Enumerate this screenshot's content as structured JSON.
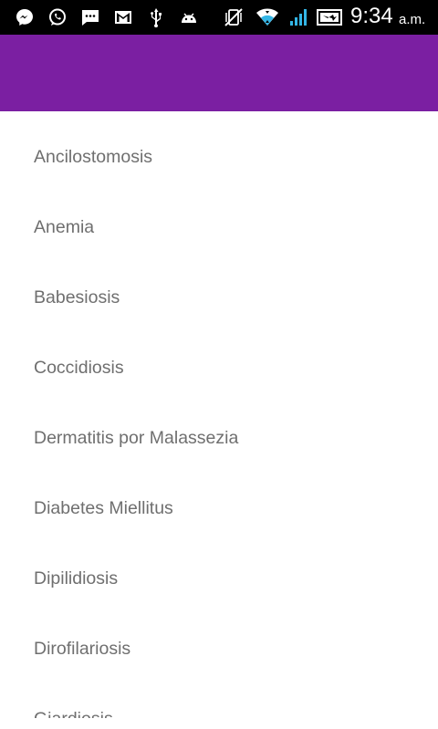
{
  "status_bar": {
    "time": "9:34",
    "ampm": "a.m.",
    "icons": [
      "messenger-icon",
      "whatsapp-icon",
      "sms-icon",
      "gmail-icon",
      "usb-icon",
      "android-debug-icon",
      "vibrate-off-icon",
      "wifi-icon",
      "signal-icon",
      "battery-charging-icon"
    ]
  },
  "colors": {
    "app_bar": "#7b1fa2",
    "text": "#6f6f6f",
    "status_bar": "#000000"
  },
  "list": {
    "items": [
      {
        "label": "Ancilostomosis"
      },
      {
        "label": "Anemia"
      },
      {
        "label": "Babesiosis"
      },
      {
        "label": "Coccidiosis"
      },
      {
        "label": "Dermatitis por Malassezia"
      },
      {
        "label": "Diabetes Miellitus"
      },
      {
        "label": "Dipilidiosis"
      },
      {
        "label": "Dirofilariosis"
      },
      {
        "label": "Giardiosis"
      }
    ]
  }
}
